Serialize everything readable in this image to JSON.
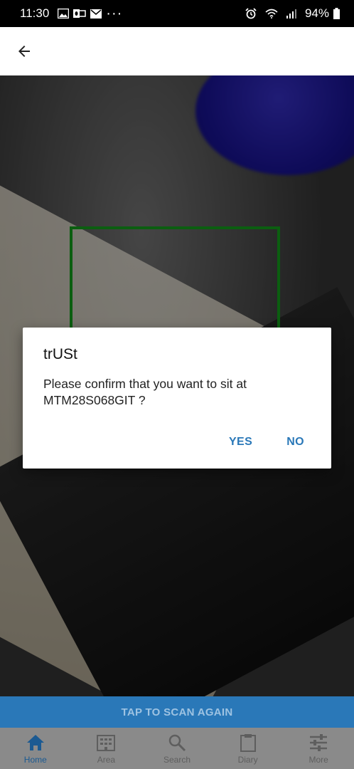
{
  "status_bar": {
    "time": "11:30",
    "notification_icons": [
      "gallery-icon",
      "outlook-icon",
      "email-icon",
      "more-dots-icon"
    ],
    "more_dots": "···",
    "battery": "94%",
    "right_icons": [
      "alarm-icon",
      "wifi-icon",
      "signal-icon",
      "battery-icon"
    ]
  },
  "app_bar": {
    "back_icon": "arrow-left-icon"
  },
  "scanner": {
    "scan_again_label": "TAP TO SCAN AGAIN",
    "frame_color": "#0b5e10"
  },
  "dialog": {
    "title": "trUSt",
    "message": "Please confirm that you want to sit at\nMTM28S068GIT ?",
    "yes_label": "YES",
    "no_label": "NO"
  },
  "bottom_nav": {
    "items": [
      {
        "label": "Home",
        "icon": "home-icon",
        "active": true
      },
      {
        "label": "Area",
        "icon": "building-icon",
        "active": false
      },
      {
        "label": "Search",
        "icon": "search-icon",
        "active": false
      },
      {
        "label": "Diary",
        "icon": "clipboard-icon",
        "active": false
      },
      {
        "label": "More",
        "icon": "sliders-icon",
        "active": false
      }
    ]
  },
  "colors": {
    "accent": "#2a78b8",
    "nav_active": "#1b5a92"
  }
}
